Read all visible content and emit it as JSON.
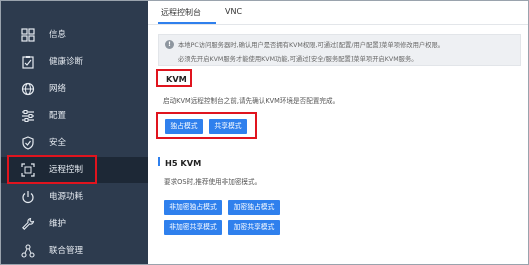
{
  "sidebar": {
    "items": [
      {
        "label": "信息",
        "icon": "grid-icon"
      },
      {
        "label": "健康诊断",
        "icon": "clipboard-icon"
      },
      {
        "label": "网络",
        "icon": "globe-icon"
      },
      {
        "label": "配置",
        "icon": "sliders-icon"
      },
      {
        "label": "安全",
        "icon": "shield-icon"
      },
      {
        "label": "远程控制",
        "icon": "remote-screen-icon"
      },
      {
        "label": "电源功耗",
        "icon": "power-icon"
      },
      {
        "label": "维护",
        "icon": "wrench-icon"
      },
      {
        "label": "联合管理",
        "icon": "network-nodes-icon"
      }
    ],
    "active_index": 5
  },
  "tabs": [
    {
      "label": "远程控制台"
    },
    {
      "label": "VNC"
    }
  ],
  "notice": {
    "icon": "info-icon",
    "line1": "本地PC访问服务器时,确认用户是否拥有KVM权限,可通过[配置/用户配置]菜单项修改用户权限。",
    "line2": "必须先开启KVM服务才能使用KVM功能,可通过[安全/服务配置]菜单项开启KVM服务。"
  },
  "kvm": {
    "title": "KVM",
    "desc": "启动KVM远程控制台之前,请先确认KVM环境是否配置完成。",
    "btn_exclusive": "独占模式",
    "btn_shared": "共享模式"
  },
  "h5kvm": {
    "title": "H5 KVM",
    "desc": "要求OS时,推荐使用非加密模式。",
    "btn_unenc_exclusive": "非加密独占模式",
    "btn_enc_exclusive": "加密独占模式",
    "btn_unenc_shared": "非加密共享模式",
    "btn_enc_shared": "加密共享模式"
  },
  "colors": {
    "sidebar_bg": "#2d3b4e",
    "sidebar_active": "#1d2836",
    "accent": "#2f80ed",
    "highlight_red": "#e0141e"
  }
}
